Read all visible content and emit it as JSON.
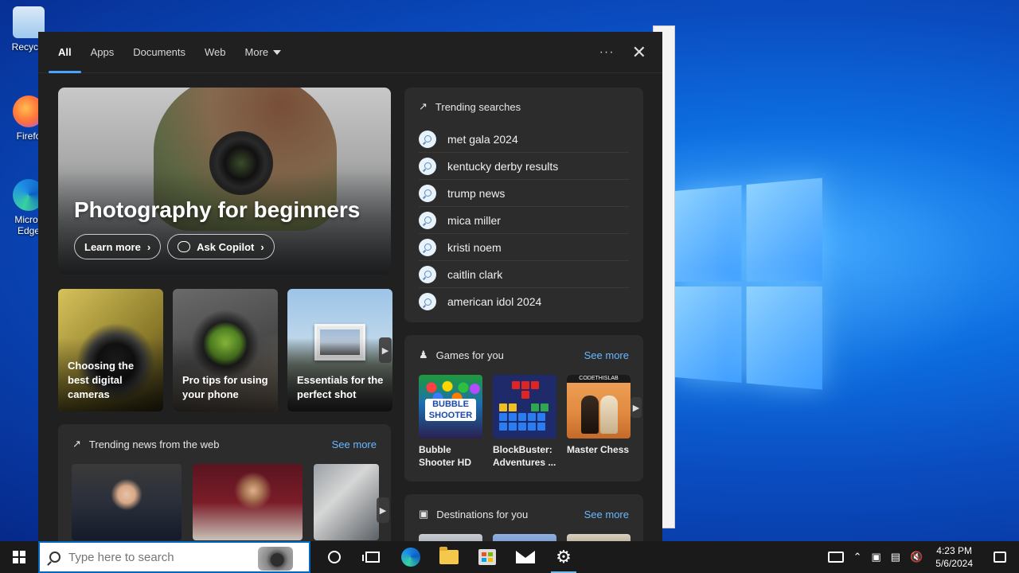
{
  "desktop": {
    "icons": [
      {
        "label": "Recycle",
        "color": "#9ec9f0"
      },
      {
        "label": "Firefo",
        "color": "#ff7139"
      },
      {
        "label": "Micros Edge",
        "color": "#1f8fe5"
      }
    ]
  },
  "tabs": {
    "all": "All",
    "apps": "Apps",
    "documents": "Documents",
    "web": "Web",
    "more": "More",
    "ellipsis": "···",
    "close": "✕"
  },
  "hero": {
    "title": "Photography for beginners",
    "learn_more": "Learn more",
    "ask_copilot": "Ask Copilot",
    "chevron": "›"
  },
  "cards": [
    {
      "label": "Choosing the best digital cameras"
    },
    {
      "label": "Pro tips for using your phone"
    },
    {
      "label": "Essentials for the perfect shot"
    }
  ],
  "news": {
    "title": "Trending news from the web",
    "see_more": "See more"
  },
  "trending": {
    "title": "Trending searches",
    "items": [
      "met gala 2024",
      "kentucky derby results",
      "trump news",
      "mica miller",
      "kristi noem",
      "caitlin clark",
      "american idol 2024"
    ]
  },
  "games": {
    "title": "Games for you",
    "see_more": "See more",
    "items": [
      {
        "name": "Bubble Shooter HD",
        "brand": "BUBBLE SHOOTER"
      },
      {
        "name": "BlockBuster: Adventures ..."
      },
      {
        "name": "Master Chess",
        "brand": "CODETHISLAB"
      }
    ]
  },
  "destinations": {
    "title": "Destinations for you",
    "see_more": "See more"
  },
  "taskbar": {
    "search_placeholder": "Type here to search",
    "time": "4:23 PM",
    "date": "5/6/2024",
    "accent": "#0067c0"
  }
}
